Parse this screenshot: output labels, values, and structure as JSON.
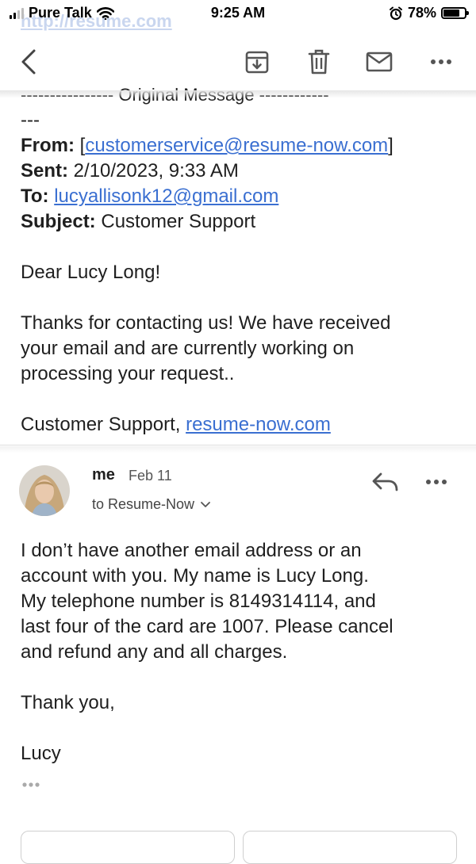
{
  "status_bar": {
    "carrier": "Pure Talk",
    "time": "9:25 AM",
    "battery_percent": "78%",
    "battery_level": 0.78
  },
  "ghost_url": "http://resume.com",
  "toolbar": {
    "icons": [
      "back-arrow-icon",
      "archive-icon",
      "trash-icon",
      "mail-icon",
      "more-icon"
    ]
  },
  "quoted_message": {
    "dashes_top": "---------------- Original Message ------------",
    "dashes_wrap": "---",
    "from_label": "From:",
    "from_open": "[",
    "from_value": "customerservice@resume-now.com",
    "from_close": "]",
    "sent_label": "Sent:",
    "sent_value": "2/10/2023, 9:33 AM",
    "to_label": "To:",
    "to_value": "lucyallisonk12@gmail.com",
    "subject_label": "Subject:",
    "subject_value": "Customer Support",
    "greeting": "Dear Lucy Long!",
    "body_lines": [
      "Thanks for contacting us! We have received",
      "your email and are currently working on",
      "processing your request.."
    ],
    "signature_prefix": "Customer Support,",
    "signature_link": "resume-now.com"
  },
  "reply_message": {
    "sender": "me",
    "date": "Feb 11",
    "to_text": "to Resume-Now",
    "body_lines": [
      "I don’t have another email address or an",
      "account with you. My name is Lucy Long.",
      "My telephone number is 8149314114, and",
      "last four of the card are 1007. Please cancel",
      "and refund any and all charges."
    ],
    "closing": "Thank you,",
    "name": "Lucy"
  }
}
